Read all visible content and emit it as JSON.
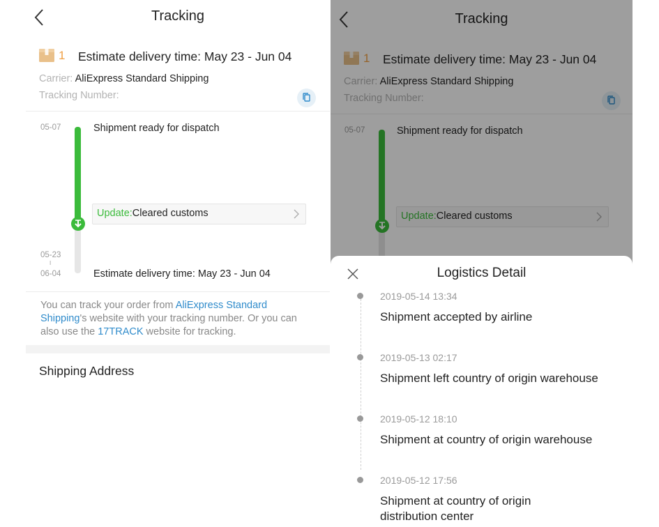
{
  "tracking": {
    "title": "Tracking",
    "package_count": "1",
    "estimate_header": "Estimate delivery time: May 23 - Jun 04",
    "carrier_label": "Carrier:",
    "carrier_name": "AliExpress Standard Shipping",
    "tracking_number_label": "Tracking Number:",
    "timeline": {
      "first_date": "05-07",
      "first_event": "Shipment ready for dispatch",
      "update_prefix": "Update:",
      "update_text": "Cleared customs",
      "est_date_start": "05-23",
      "est_date_sep": "I",
      "est_date_end": "06-04",
      "est_event": "Estimate delivery time: May 23 - Jun 04"
    },
    "info": {
      "part1": "You can track your order from ",
      "link1": "AliExpress Standard Shipping",
      "part2": "'s website with your tracking number. Or you can also use the ",
      "link2": "17TRACK",
      "part3": " website for tracking."
    },
    "shipping_address_label": "Shipping Address"
  },
  "logistics": {
    "title": "Logistics Detail",
    "events": [
      {
        "time": "2019-05-14 13:34",
        "desc": "Shipment accepted by airline"
      },
      {
        "time": "2019-05-13 02:17",
        "desc": "Shipment left country of origin warehouse"
      },
      {
        "time": "2019-05-12 18:10",
        "desc": "Shipment at country of origin warehouse"
      },
      {
        "time": "2019-05-12 17:56",
        "desc": "Shipment at country of origin distribution center"
      }
    ]
  },
  "icons": {
    "back": "chevron-left-icon",
    "package": "package-icon",
    "copy": "copy-icon",
    "update_chevron": "chevron-right-icon",
    "close": "close-icon",
    "timeline_node": "arrow-down-icon"
  },
  "colors": {
    "accent_green": "#3bbb3b",
    "link_blue": "#2f8bcb",
    "package_orange": "#f0a044",
    "overlay": "rgba(0,0,0,0.38)"
  }
}
